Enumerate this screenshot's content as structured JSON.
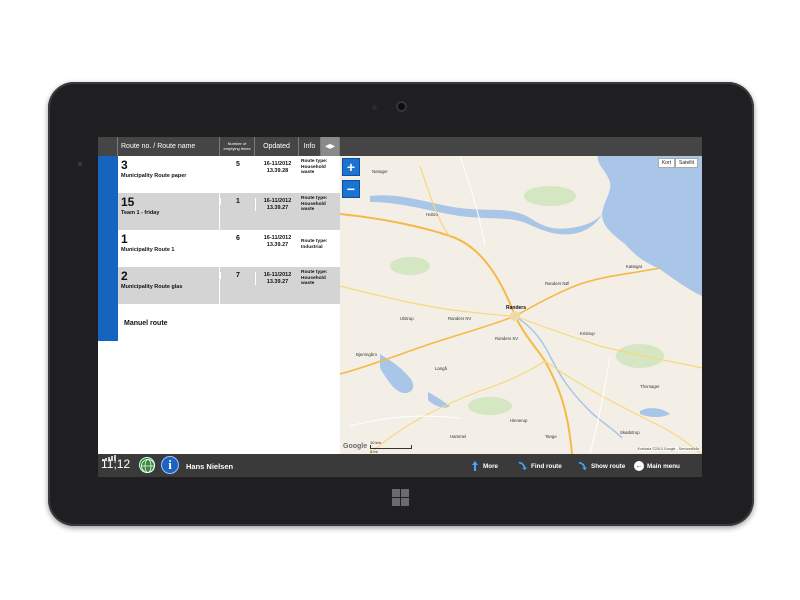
{
  "header": {
    "route_label": "Route no. / Route name",
    "count_label": "Number of emptying times",
    "updated_label": "Opdated",
    "info_label": "Info",
    "columns_glyph": "◂▸"
  },
  "routes": [
    {
      "number": "3",
      "name": "Municipality Route paper",
      "count": "5",
      "date": "16-11/2012",
      "time": "13.39.28",
      "type_label": "Route type:",
      "type": "Household waste"
    },
    {
      "number": "15",
      "name": "Team 1 - friday",
      "count": "1",
      "date": "16-11/2012",
      "time": "13.39.27",
      "type_label": "Route type:",
      "type": "Household waste"
    },
    {
      "number": "1",
      "name": "Municipality Route 1",
      "count": "6",
      "date": "16-11/2012",
      "time": "13.39.27",
      "type_label": "Route type:",
      "type": "Industrial"
    },
    {
      "number": "2",
      "name": "Municipality Route glas",
      "count": "7",
      "date": "16-11/2012",
      "time": "13.39.27",
      "type_label": "Route type:",
      "type": "Household waste"
    }
  ],
  "manual_route_label": "Manuel route",
  "map": {
    "zoom_in": "+",
    "zoom_out": "−",
    "type_map": "Kort",
    "type_satellite": "Satellit",
    "scale_top": "10 km",
    "scale_bottom": "5 mi",
    "logo": "Google",
    "copyright": "Kortdata ©2013 Google - Servicevilkår",
    "main_city": "Randers",
    "towns": [
      "Nørager",
      "Hobro",
      "Randers NV",
      "Randers NØ",
      "Randers SV",
      "Langå",
      "Ulstrup",
      "Bjerringbro",
      "Thorsager",
      "Skødstrup",
      "Hammel",
      "Hinnerup",
      "Tange",
      "Kristrup",
      "Kattegat"
    ]
  },
  "bottom": {
    "clock": "11;12",
    "user": "Hans Nielsen",
    "more": "More",
    "find_route": "Find route",
    "show_route": "Show route",
    "main_menu": "Main menu"
  },
  "colors": {
    "accent": "#1565c0",
    "header": "#454545",
    "bottom_bar": "#3a3a3a",
    "row_alt": "#d4d4d4",
    "water": "#a9c6e8",
    "main_road": "#f5b94a"
  }
}
